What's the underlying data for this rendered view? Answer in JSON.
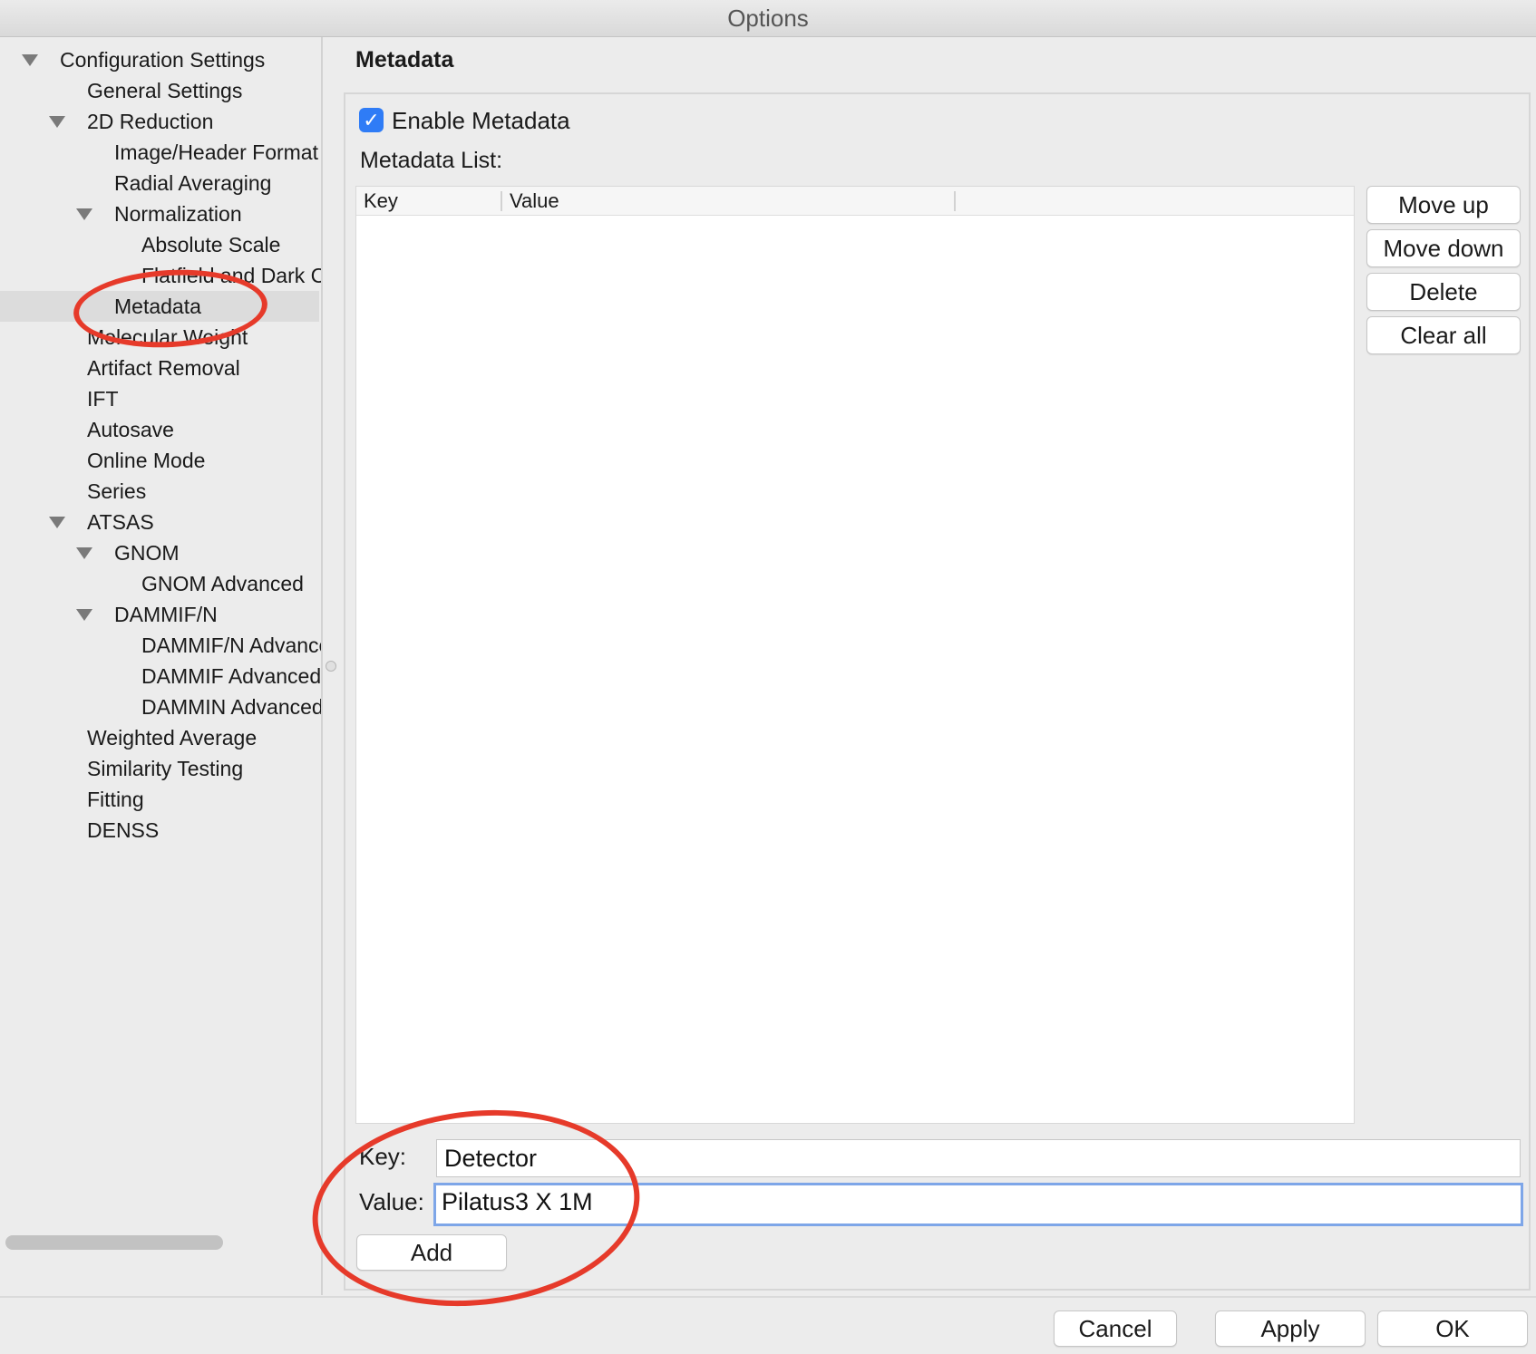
{
  "window": {
    "title": "Options"
  },
  "tree": {
    "items": [
      {
        "label": "Configuration Settings",
        "expanded": true
      },
      {
        "label": "General Settings"
      },
      {
        "label": "2D Reduction",
        "expanded": true
      },
      {
        "label": "Image/Header Format"
      },
      {
        "label": "Radial Averaging"
      },
      {
        "label": "Normalization",
        "expanded": true
      },
      {
        "label": "Absolute Scale"
      },
      {
        "label": "Flatfield and Dark Correction"
      },
      {
        "label": "Metadata",
        "selected": true
      },
      {
        "label": "Molecular Weight"
      },
      {
        "label": "Artifact Removal"
      },
      {
        "label": "IFT"
      },
      {
        "label": "Autosave"
      },
      {
        "label": "Online Mode"
      },
      {
        "label": "Series"
      },
      {
        "label": "ATSAS",
        "expanded": true
      },
      {
        "label": "GNOM",
        "expanded": true
      },
      {
        "label": "GNOM Advanced"
      },
      {
        "label": "DAMMIF/N",
        "expanded": true
      },
      {
        "label": "DAMMIF/N Advanced"
      },
      {
        "label": "DAMMIF Advanced"
      },
      {
        "label": "DAMMIN Advanced"
      },
      {
        "label": "Weighted Average"
      },
      {
        "label": "Similarity Testing"
      },
      {
        "label": "Fitting"
      },
      {
        "label": "DENSS"
      }
    ]
  },
  "panel": {
    "title": "Metadata",
    "enable_checkbox": {
      "label": "Enable Metadata",
      "checked": true
    },
    "list_label": "Metadata List:",
    "list_columns": [
      "Key",
      "Value"
    ],
    "list_buttons": [
      "Move up",
      "Move down",
      "Delete",
      "Clear all"
    ],
    "key_label": "Key:",
    "key_value": "Detector",
    "value_label": "Value:",
    "value_value": "Pilatus3 X 1M",
    "add_button": "Add"
  },
  "footer": {
    "cancel": "Cancel",
    "apply": "Apply",
    "ok": "OK"
  },
  "colors": {
    "checkbox_accent": "#2f7cf6",
    "annotation": "#e63a2a",
    "focus_ring": "#7ea6e8"
  }
}
